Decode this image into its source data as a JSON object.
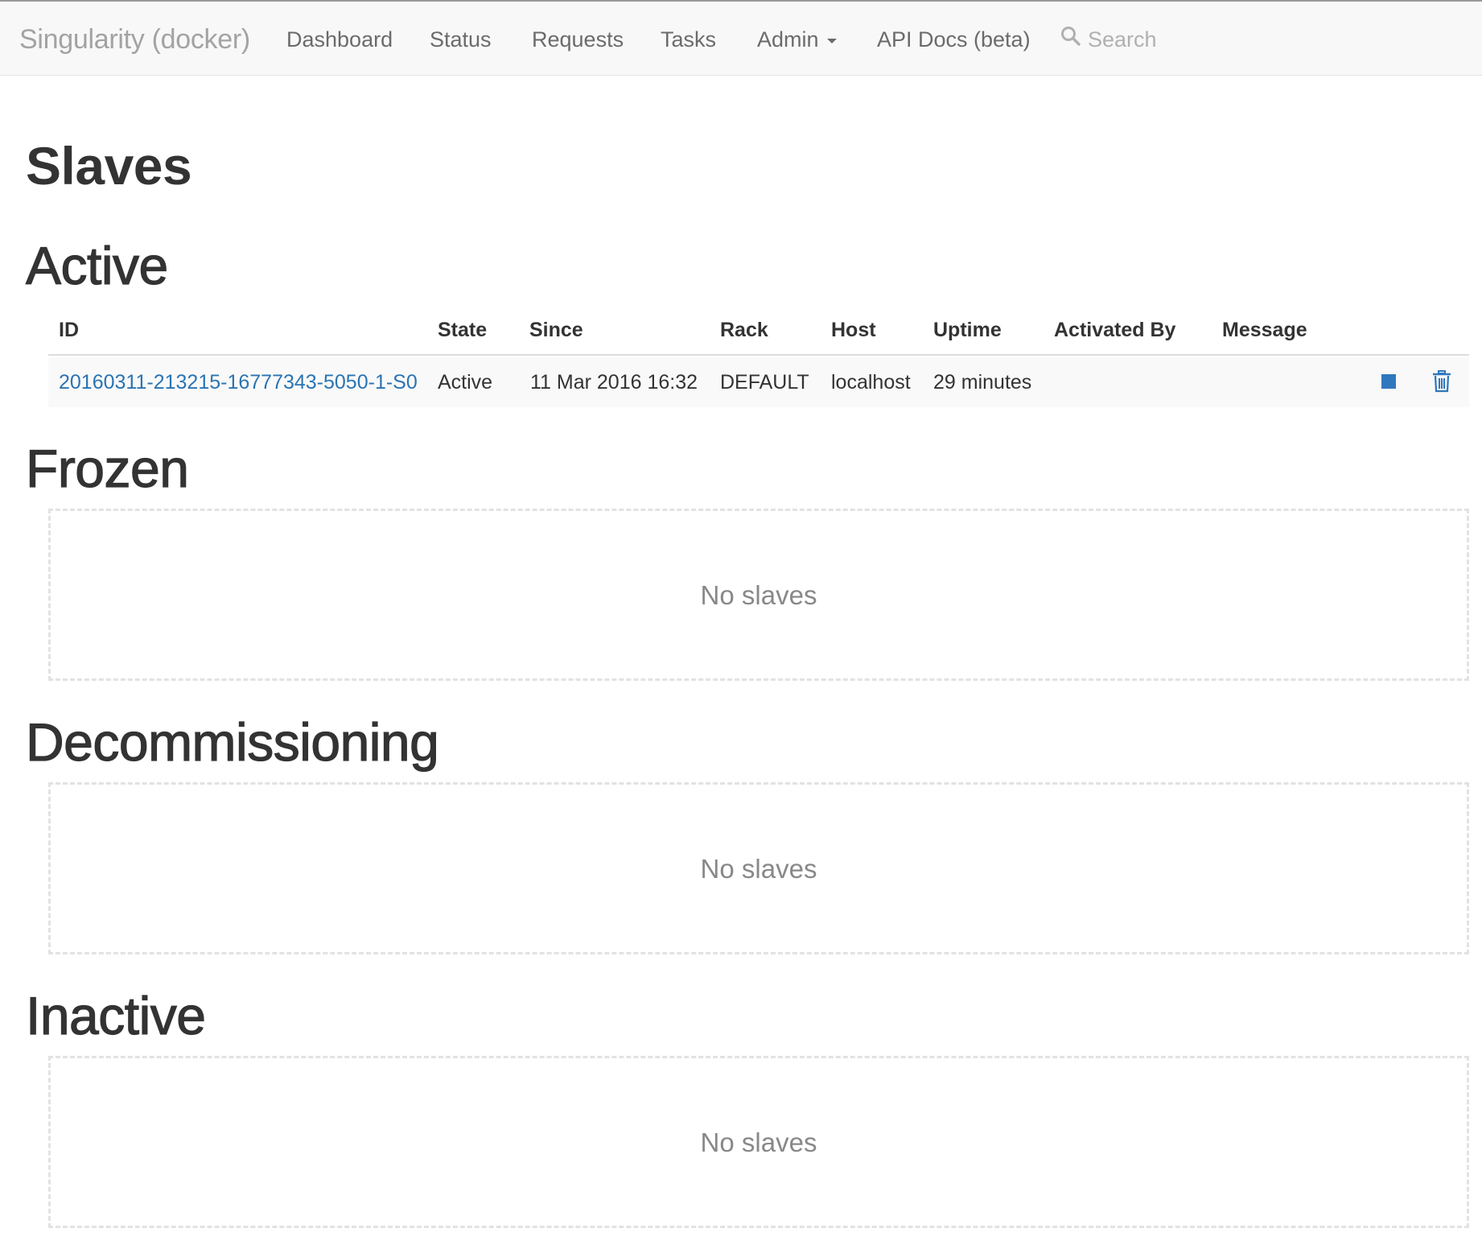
{
  "navbar": {
    "brand": "Singularity (docker)",
    "items": [
      {
        "label": "Dashboard"
      },
      {
        "label": "Status"
      },
      {
        "label": "Requests"
      },
      {
        "label": "Tasks"
      },
      {
        "label": "Admin"
      },
      {
        "label": "API Docs (beta)"
      }
    ],
    "search": {
      "placeholder": "Search",
      "icon": "search-icon"
    }
  },
  "page": {
    "title": "Slaves"
  },
  "sections": {
    "active": {
      "title": "Active",
      "columns": [
        "ID",
        "State",
        "Since",
        "Rack",
        "Host",
        "Uptime",
        "Activated By",
        "Message"
      ],
      "rows": [
        {
          "id": "20160311-213215-16777343-5050-1-S0",
          "state": "Active",
          "since": "11 Mar 2016 16:32",
          "rack": "DEFAULT",
          "host": "localhost",
          "uptime": "29 minutes",
          "activated_by": "",
          "message": "",
          "actions": [
            "freeze-icon",
            "trash-icon"
          ]
        }
      ]
    },
    "frozen": {
      "title": "Frozen",
      "empty_text": "No slaves"
    },
    "decommissioning": {
      "title": "Decommissioning",
      "empty_text": "No slaves"
    },
    "inactive": {
      "title": "Inactive",
      "empty_text": "No slaves"
    }
  },
  "colors": {
    "link": "#2a74b3",
    "action_icon": "#2f78bd",
    "navbar_bg": "#f8f8f8"
  }
}
